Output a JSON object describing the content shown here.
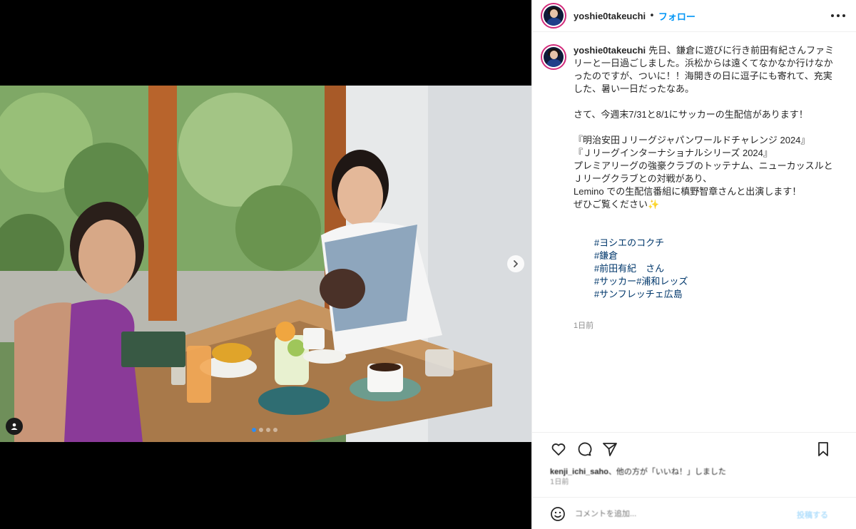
{
  "header": {
    "username": "yoshie0takeuchi",
    "separator": "•",
    "follow_label": "フォロー"
  },
  "caption": {
    "username": "yoshie0takeuchi",
    "paragraph1": "先日、鎌倉に遊びに行き前田有紀さんファミリーと一日過ごしました。浜松からは遠くてなかなか行けなかったのですが、ついに！！海開きの日に逗子にも寄れて、充実した、暑い一日だったなあ。",
    "paragraph2": "さて、今週末7/31と8/1にサッカーの生配信があります！",
    "paragraph3": "『明治安田Ｊリーグジャパンワールドチャレンジ 2024』\n『Ｊリーグインターナショナルシリーズ 2024』\nプレミアリーグの強豪クラブのトッテナム、ニューカッスルとＪリーグクラブとの対戦があり、\nLemino での生配信番組に槙野智章さんと出演します！\nぜひご覧ください✨",
    "hashtags": [
      "#ヨシエのコクチ",
      "#鎌倉",
      "#前田有紀　さん",
      "#サッカー",
      "#浦和レッズ",
      "#サンフレッチェ広島"
    ],
    "time": "1日前"
  },
  "actions": {
    "likes_user": "kenji_ichi_saho",
    "likes_suffix": "、他の方が「いいね！」しました",
    "date": "1日前",
    "comment_placeholder": "コメントを追加...",
    "post_label": "投稿する"
  },
  "carousel": {
    "slides": 4,
    "current": 1
  },
  "icons": {
    "more": "more-horizontal-icon",
    "like": "heart-icon",
    "comment": "comment-icon",
    "share": "share-icon",
    "save": "bookmark-icon",
    "emoji": "emoji-icon",
    "next": "chevron-right-icon",
    "tag": "user-tag-icon"
  },
  "colors": {
    "accent": "#0095f6",
    "hashtag": "#00376b",
    "story_ring": "#d12a7a"
  }
}
